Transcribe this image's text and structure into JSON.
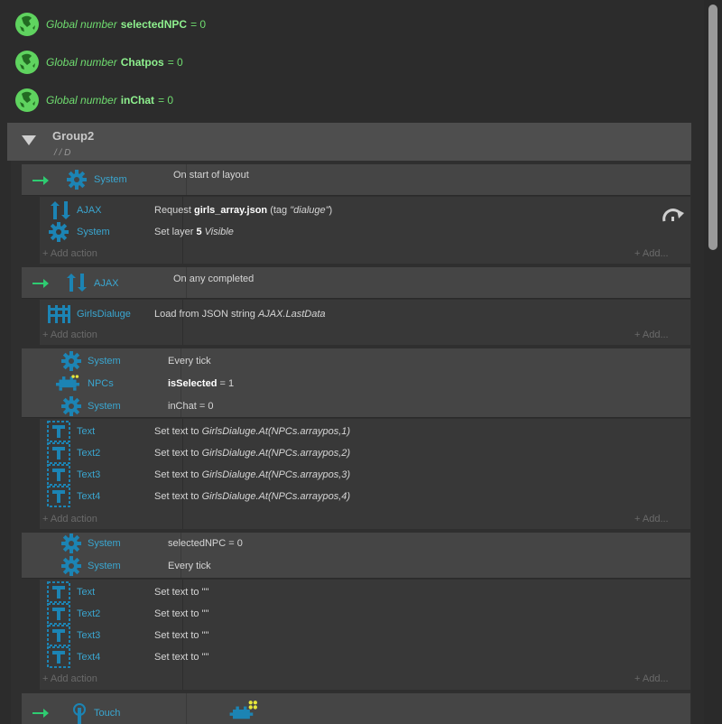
{
  "globals": [
    {
      "keyword": "Global number",
      "name": "selectedNPC",
      "eq": "= 0"
    },
    {
      "keyword": "Global number",
      "name": "Chatpos",
      "eq": "= 0"
    },
    {
      "keyword": "Global number",
      "name": "inChat",
      "eq": "= 0"
    }
  ],
  "group": {
    "title": "Group2",
    "desc": "/ /  D"
  },
  "events": [
    {
      "conditions": [
        {
          "object": "System",
          "text": "On start of layout"
        }
      ],
      "actions": [
        {
          "object": "AJAX",
          "pre": "Request ",
          "bold": "girls_array.json",
          "mid": " (tag ",
          "ital": "\"dialuge\"",
          "post": ")"
        },
        {
          "object": "System",
          "pre": "Set layer ",
          "bold": "5",
          "mid": " ",
          "ital": "Visible",
          "post": ""
        }
      ]
    },
    {
      "conditions": [
        {
          "object": "AJAX",
          "text": "On any completed"
        }
      ],
      "actions": [
        {
          "object": "GirlsDialuge",
          "pre": "Load from JSON string ",
          "bold": "",
          "mid": "",
          "ital": "AJAX.LastData",
          "post": ""
        }
      ]
    },
    {
      "conditions": [
        {
          "object": "System",
          "text": "Every tick"
        },
        {
          "object": "NPCs",
          "bold": "isSelected",
          "text": " = 1"
        },
        {
          "object": "System",
          "text": "inChat = 0"
        }
      ],
      "actions": [
        {
          "object": "Text",
          "pre": "Set text to ",
          "bold": "",
          "mid": "",
          "ital": "GirlsDialuge.At(NPCs.arraypos,1)",
          "post": ""
        },
        {
          "object": "Text2",
          "pre": "Set text to ",
          "bold": "",
          "mid": "",
          "ital": "GirlsDialuge.At(NPCs.arraypos,2)",
          "post": ""
        },
        {
          "object": "Text3",
          "pre": "Set text to ",
          "bold": "",
          "mid": "",
          "ital": "GirlsDialuge.At(NPCs.arraypos,3)",
          "post": ""
        },
        {
          "object": "Text4",
          "pre": "Set text to ",
          "bold": "",
          "mid": "",
          "ital": "GirlsDialuge.At(NPCs.arraypos,4)",
          "post": ""
        }
      ]
    },
    {
      "conditions": [
        {
          "object": "System",
          "text": "selectedNPC = 0"
        },
        {
          "object": "System",
          "text": "Every tick"
        }
      ],
      "actions": [
        {
          "object": "Text",
          "pre": "Set text to \"\"",
          "bold": "",
          "mid": "",
          "ital": "",
          "post": ""
        },
        {
          "object": "Text2",
          "pre": "Set text to \"\"",
          "bold": "",
          "mid": "",
          "ital": "",
          "post": ""
        },
        {
          "object": "Text3",
          "pre": "Set text to \"\"",
          "bold": "",
          "mid": "",
          "ital": "",
          "post": ""
        },
        {
          "object": "Text4",
          "pre": "Set text to \"\"",
          "bold": "",
          "mid": "",
          "ital": "",
          "post": ""
        }
      ]
    },
    {
      "conditions": [
        {
          "object": "Touch",
          "text": ""
        }
      ],
      "actions": []
    }
  ],
  "labels": {
    "add_action": "Add action",
    "add_more": "Add..."
  },
  "colors": {
    "accent_green": "#2ecc71",
    "object_blue": "#3aa6d0",
    "icon_blue": "#1c84b4"
  }
}
